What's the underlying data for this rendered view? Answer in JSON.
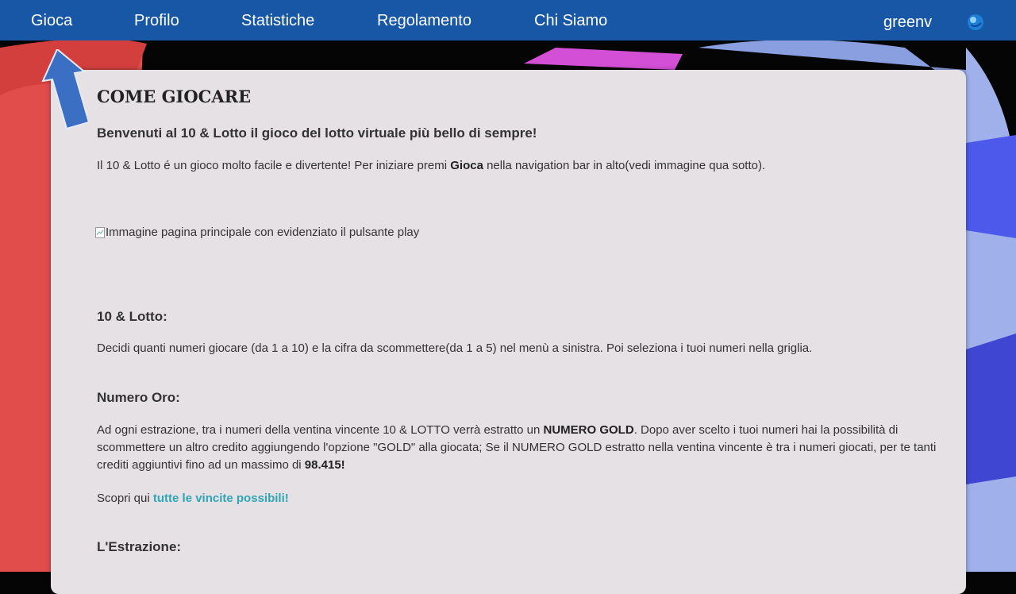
{
  "nav": {
    "items": [
      "Gioca",
      "Profilo",
      "Statistiche",
      "Regolamento",
      "Chi Siamo"
    ],
    "username": "greenv",
    "avatar_icon": "globe-avatar-icon"
  },
  "content": {
    "title": "COME GIOCARE",
    "welcome": "Benvenuti al 10 & Lotto il gioco del lotto virtuale più bello di sempre!",
    "intro": {
      "before": "Il 10 & Lotto é un gioco molto facile e divertente! Per iniziare premi ",
      "bold": "Gioca",
      "after": " nella navigation bar in alto(vedi immagine qua sotto)."
    },
    "image_alt": "Immagine pagina principale con evidenziato il pulsante play",
    "section1": {
      "title": "10 & Lotto:",
      "text": "Decidi quanti numeri giocare (da 1 a 10) e la cifra da scommettere(da 1 a 5) nel menù a sinistra. Poi seleziona i tuoi numeri nella griglia."
    },
    "section2": {
      "title": "Numero Oro:",
      "text_a": "Ad ogni estrazione, tra i numeri della ventina vincente 10 & LOTTO verrà estratto un ",
      "bold_a": "NUMERO GOLD",
      "text_b": ". Dopo aver scelto i tuoi numeri hai la possibilità di scommettere un altro credito aggiungendo l'opzione \"GOLD\" alla giocata; Se il NUMERO GOLD estratto nella ventina vincente è tra i numeri giocati, per te tanti crediti aggiuntivi fino ad un massimo di ",
      "bold_b": "98.415!",
      "discover_prefix": "Scopri qui ",
      "discover_link": "tutte le vincite possibili!"
    },
    "section3": {
      "title": "L'Estrazione:"
    }
  },
  "colors": {
    "navbar": "#1757a6",
    "panel": "#e6e1e4",
    "link": "#2fa6b5",
    "arrow": "#3a6fc4"
  }
}
